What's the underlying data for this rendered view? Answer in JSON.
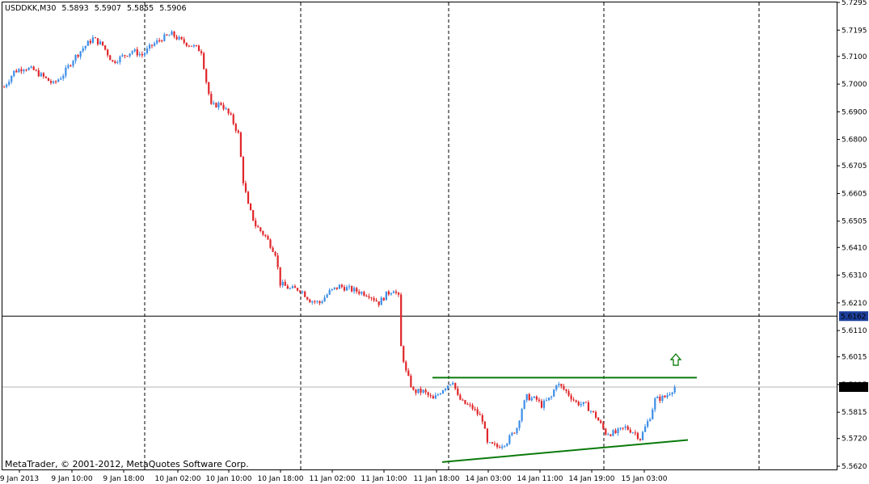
{
  "header": {
    "symbol": "USDDKK,M30",
    "open": "5.5893",
    "high": "5.5907",
    "low": "5.5855",
    "close": "5.5906"
  },
  "copyright": "MetaTrader, © 2001-2012, MetaQuotes Software Corp.",
  "colors": {
    "bull": "#3c8ee6",
    "bear": "#e0262a",
    "grid": "#000000",
    "trend": "#0a7a0a",
    "arrow": "#0a7a0a",
    "price_label_bg": "#1c3f9c",
    "price_label_text": "#ffffff"
  },
  "icons": {
    "up_arrow": "up-arrow-icon"
  },
  "chart_data": {
    "type": "candlestick",
    "y_ticks": [
      "5.7295",
      "5.7195",
      "5.7100",
      "5.7000",
      "5.6900",
      "5.6800",
      "5.6705",
      "5.6605",
      "5.6505",
      "5.6410",
      "5.6310",
      "5.6210",
      "5.6110",
      "5.6015",
      "5.5915",
      "5.5815",
      "5.5720",
      "5.5620"
    ],
    "ylim": [
      5.562,
      5.7295
    ],
    "x_ticks": [
      "9 Jan 2013",
      "9 Jan 10:00",
      "9 Jan 18:00",
      "10 Jan 02:00",
      "10 Jan 10:00",
      "10 Jan 18:00",
      "11 Jan 02:00",
      "11 Jan 10:00",
      "11 Jan 18:00",
      "14 Jan 03:00",
      "14 Jan 11:00",
      "14 Jan 19:00",
      "15 Jan 03:00"
    ],
    "separators": [
      "9 Jan 18:00",
      "10 Jan 18:00",
      "11 Jan 18:00",
      "14 Jan 19:00"
    ],
    "horizontal_line": {
      "price": "5.6162"
    },
    "bid_line": {
      "price": "5.5906"
    },
    "resistance_line": {
      "from": [
        "11 Jan 14:00",
        5.594
      ],
      "to": [
        "15 Jan 13:00",
        5.594
      ]
    },
    "support_line": {
      "from": [
        "11 Jan 18:00",
        5.5635
      ],
      "to": [
        "15 Jan 12:00",
        5.5715
      ]
    },
    "arrow": {
      "at": "15 Jan 06:00",
      "price": 5.6005,
      "direction": "up"
    },
    "candles_note": "approximate close path of ~280 M30 bars",
    "close_path": [
      [
        0,
        5.699
      ],
      [
        4,
        5.7045
      ],
      [
        8,
        5.706
      ],
      [
        12,
        5.705
      ],
      [
        16,
        5.7025
      ],
      [
        20,
        5.7
      ],
      [
        24,
        5.7035
      ],
      [
        28,
        5.709
      ],
      [
        32,
        5.713
      ],
      [
        36,
        5.7165
      ],
      [
        40,
        5.714
      ],
      [
        44,
        5.708
      ],
      [
        48,
        5.71
      ],
      [
        52,
        5.712
      ],
      [
        56,
        5.7105
      ],
      [
        60,
        5.714
      ],
      [
        64,
        5.7165
      ],
      [
        68,
        5.718
      ],
      [
        72,
        5.7155
      ],
      [
        76,
        5.714
      ],
      [
        80,
        5.712
      ],
      [
        82,
        5.701
      ],
      [
        84,
        5.692
      ],
      [
        88,
        5.693
      ],
      [
        92,
        5.688
      ],
      [
        95,
        5.682
      ],
      [
        97,
        5.665
      ],
      [
        99,
        5.656
      ],
      [
        102,
        5.649
      ],
      [
        106,
        5.645
      ],
      [
        110,
        5.639
      ],
      [
        112,
        5.628
      ],
      [
        116,
        5.626
      ],
      [
        120,
        5.626
      ],
      [
        124,
        5.622
      ],
      [
        128,
        5.621
      ],
      [
        132,
        5.625
      ],
      [
        136,
        5.627
      ],
      [
        140,
        5.626
      ],
      [
        144,
        5.625
      ],
      [
        148,
        5.624
      ],
      [
        152,
        5.621
      ],
      [
        155,
        5.624
      ],
      [
        158,
        5.626
      ],
      [
        160,
        5.623
      ],
      [
        161,
        5.605
      ],
      [
        163,
        5.596
      ],
      [
        166,
        5.589
      ],
      [
        170,
        5.589
      ],
      [
        174,
        5.586
      ],
      [
        178,
        5.59
      ],
      [
        182,
        5.593
      ],
      [
        184,
        5.587
      ],
      [
        186,
        5.585
      ],
      [
        190,
        5.583
      ],
      [
        194,
        5.579
      ],
      [
        196,
        5.57
      ],
      [
        200,
        5.569
      ],
      [
        204,
        5.571
      ],
      [
        208,
        5.576
      ],
      [
        210,
        5.583
      ],
      [
        212,
        5.587
      ],
      [
        216,
        5.586
      ],
      [
        218,
        5.584
      ],
      [
        222,
        5.587
      ],
      [
        224,
        5.592
      ],
      [
        228,
        5.589
      ],
      [
        232,
        5.585
      ],
      [
        236,
        5.584
      ],
      [
        240,
        5.58
      ],
      [
        244,
        5.574
      ],
      [
        248,
        5.574
      ],
      [
        252,
        5.576
      ],
      [
        256,
        5.574
      ],
      [
        258,
        5.572
      ],
      [
        262,
        5.58
      ],
      [
        264,
        5.586
      ],
      [
        268,
        5.587
      ],
      [
        272,
        5.5906
      ]
    ]
  }
}
